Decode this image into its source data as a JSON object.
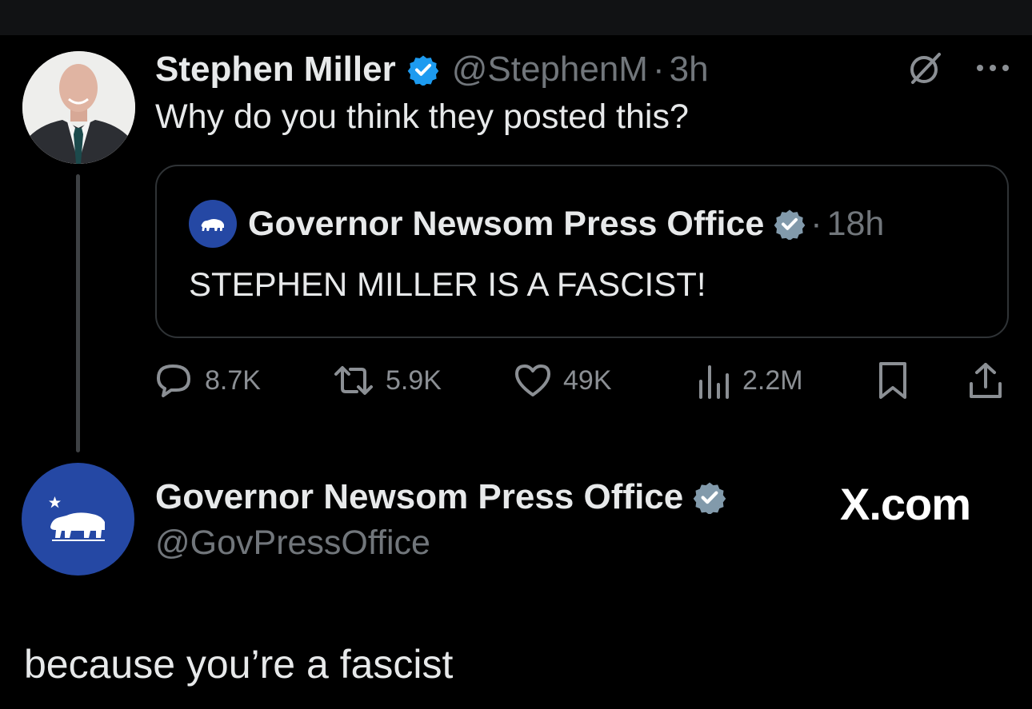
{
  "original_tweet": {
    "author_name": "Stephen Miller",
    "handle": "@StephenM",
    "separator": "·",
    "timestamp": "3h",
    "text": "Why do you think they posted this?",
    "verified_color": "#1d9bf0",
    "avatar_icon": "person-photo"
  },
  "quoted_tweet": {
    "author_name": "Governor Newsom Press Office",
    "separator": "·",
    "timestamp": "18h",
    "text": "STEPHEN MILLER IS A FASCIST!",
    "verified_color": "#829aab",
    "avatar_icon": "california-bear-icon"
  },
  "actions": {
    "replies": "8.7K",
    "reposts": "5.9K",
    "likes": "49K",
    "views": "2.2M"
  },
  "reply": {
    "author_name": "Governor Newsom Press Office",
    "handle": "@GovPressOffice",
    "text": "because you’re a fascist",
    "verified_color": "#829aab"
  },
  "watermark": "X.com",
  "colors": {
    "background": "#000000",
    "text": "#e7e9ea",
    "muted": "#71767b",
    "brand_blue": "#2548a4"
  }
}
